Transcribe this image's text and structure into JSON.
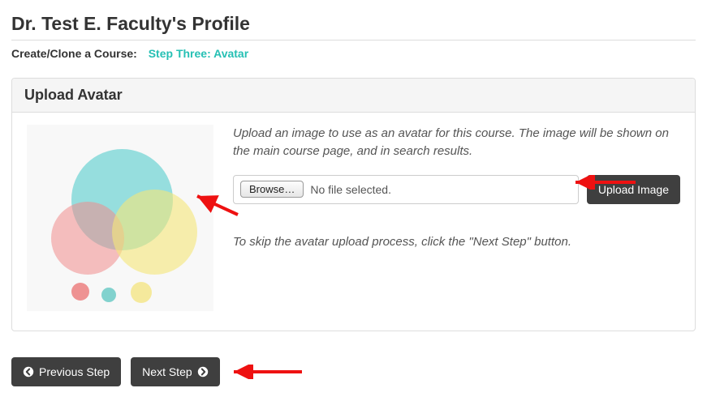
{
  "page_title": "Dr. Test E. Faculty's Profile",
  "subhead_label": "Create/Clone a Course:",
  "subhead_step": "Step Three: Avatar",
  "panel_title": "Upload Avatar",
  "instruction_text": "Upload an image to use as an avatar for this course. The image will be shown on the main course page, and in search results.",
  "browse_label": "Browse…",
  "file_status": "No file selected.",
  "upload_button": "Upload Image",
  "skip_text": "To skip the avatar upload process, click the \"Next Step\" button.",
  "prev_button": "Previous Step",
  "next_button": "Next Step"
}
